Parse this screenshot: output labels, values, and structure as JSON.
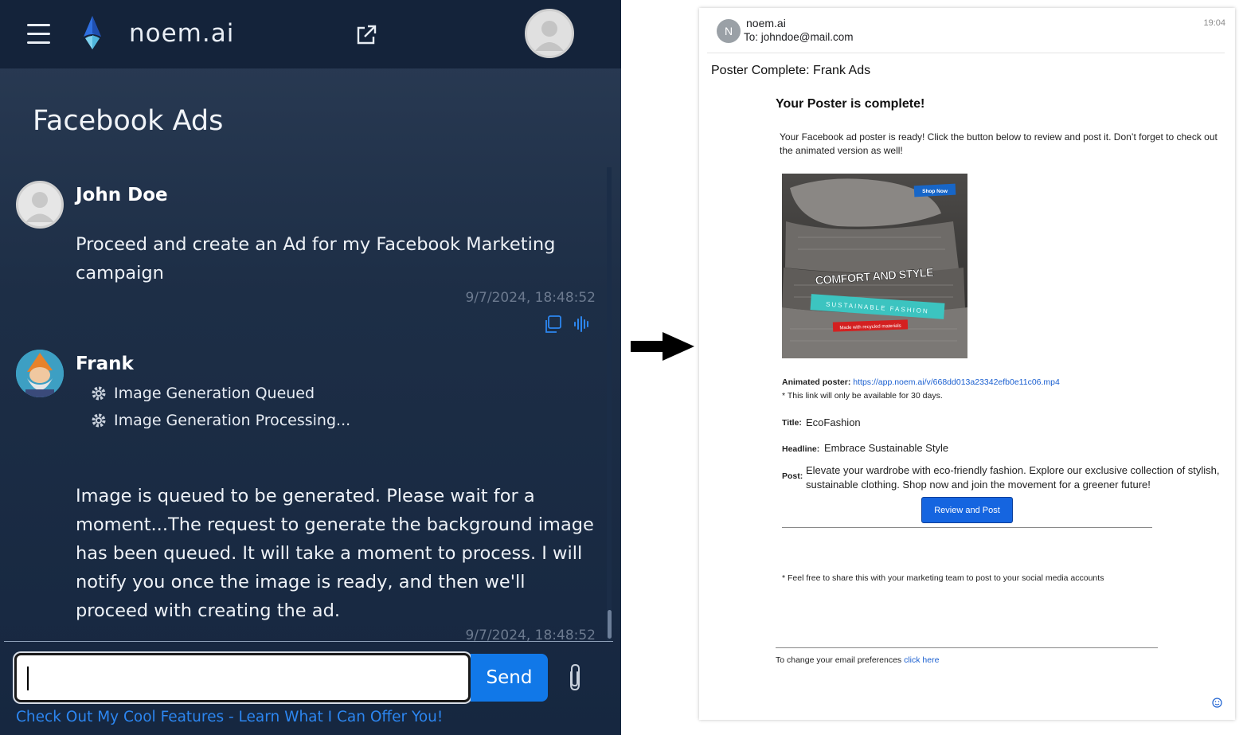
{
  "app": {
    "brand": "noem.ai",
    "chat_title": "Facebook Ads"
  },
  "messages": [
    {
      "sender": "John Doe",
      "text": "Proceed and create an Ad for my Facebook Marketing campaign",
      "timestamp": "9/7/2024, 18:48:52",
      "icons": [
        "copy-icon",
        "audio-wave-icon"
      ]
    },
    {
      "sender": "Frank",
      "statuses": [
        "Image Generation Queued",
        "Image Generation Processing..."
      ],
      "text": "Image is queued to be generated. Please wait for a moment...The request to generate the background image has been queued. It will take a moment to process. I will notify you once the image is ready, and then we'll proceed with creating the ad.",
      "timestamp": "9/7/2024, 18:48:52"
    }
  ],
  "composer": {
    "input_value": "",
    "send_label": "Send",
    "features_link": "Check Out My Cool Features - Learn What I Can Offer You!"
  },
  "email": {
    "avatar_letter": "N",
    "from": "noem.ai",
    "to": "To: johndoe@mail.com",
    "time": "19:04",
    "subject": "Poster Complete: Frank Ads",
    "heading": "Your Poster is complete!",
    "intro": "Your Facebook ad poster is ready! Click the button below to review and post it. Don’t forget to check out the animated version as well!",
    "poster": {
      "shop_now": "Shop Now",
      "headline": "COMFORT AND STYLE",
      "band": "SUSTAINABLE FASHION",
      "tag": "Made with recycled materials"
    },
    "animated_label": "Animated poster:",
    "animated_url": "https://app.noem.ai/v/668dd013a23342efb0e11c06.mp4",
    "link_note": "* This link will only be available for 30 days.",
    "title_label": "Title:",
    "title_value": "EcoFashion",
    "headline_label": "Headline:",
    "headline_value": "Embrace Sustainable Style",
    "post_label": "Post:",
    "post_value": "Elevate your wardrobe with eco-friendly fashion. Explore our exclusive collection of stylish, sustainable clothing. Shop now and join the movement for a greener future!",
    "button_label": "Review and Post",
    "share_note": "* Feel free to share this with your marketing team to post to your social media accounts",
    "prefs_text": "To change your email preferences",
    "prefs_link": "click here"
  },
  "colors": {
    "accent": "#1178e8",
    "topbar": "#14233a",
    "link": "#2c86f0",
    "email_button": "#1565e0"
  }
}
